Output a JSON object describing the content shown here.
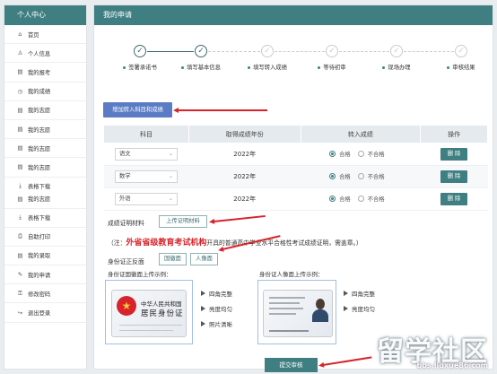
{
  "sidebar": {
    "title": "个人中心",
    "items": [
      {
        "icon": "⌂",
        "label": "首页"
      },
      {
        "icon": "♙",
        "label": "个人信息"
      },
      {
        "icon": "▤",
        "label": "我的报考"
      },
      {
        "icon": "◷",
        "label": "我的成绩"
      },
      {
        "icon": "▤",
        "label": "我的志愿"
      },
      {
        "icon": "▤",
        "label": "我的志愿"
      },
      {
        "icon": "▤",
        "label": "我的志愿"
      },
      {
        "icon": "▤",
        "label": "我的志愿"
      },
      {
        "icon": "⤓",
        "label": "表格下载",
        "sub_icon": "▤",
        "sub_label": "我的志愿"
      },
      {
        "icon": "⤓",
        "label": "表格下载"
      },
      {
        "icon": "⎙",
        "label": "自助打印"
      },
      {
        "icon": "▤",
        "label": "我的录取"
      },
      {
        "icon": "✎",
        "label": "我的申请"
      },
      {
        "icon": "⚿",
        "label": "修改密码"
      },
      {
        "icon": "↪",
        "label": "退出登录"
      }
    ]
  },
  "main": {
    "title": "我的申请",
    "steps": [
      {
        "label": "签署承诺书",
        "done": true
      },
      {
        "label": "填写基本信息",
        "done": true
      },
      {
        "label": "填写转入成绩",
        "done": false
      },
      {
        "label": "等待初审",
        "done": false
      },
      {
        "label": "现场办理",
        "done": false
      },
      {
        "label": "审核结果",
        "done": false
      }
    ],
    "check_glyph": "✓",
    "add_button": "增加转入科目和成绩",
    "table": {
      "headers": [
        "科目",
        "取得成绩年份",
        "转入成绩",
        "操作"
      ],
      "rows": [
        {
          "subject": "语文",
          "year": "2022年",
          "pass": "合格",
          "fail": "不合格",
          "action": "删 除"
        },
        {
          "subject": "数学",
          "year": "2022年",
          "pass": "合格",
          "fail": "不合格",
          "action": "删 除"
        },
        {
          "subject": "外语",
          "year": "2022年",
          "pass": "合格",
          "fail": "不合格",
          "action": "删 除"
        }
      ]
    },
    "proof_label": "成绩证明材料",
    "upload_proof": "上传证明材料",
    "note_prefix": "（注：",
    "note_highlight": "外省省级教育考试机构",
    "note_suffix": "开具的普通高中学业水平合格性考试成绩证明，需盖章。）",
    "id_label": "身份证正反面",
    "emblem_side_btn": "国徽面",
    "portrait_side_btn": "人像面",
    "emblem_sample_title": "身份证国徽面上传示例：",
    "portrait_sample_title": "身份证人像面上传示例：",
    "emblem_card": {
      "line1": "中华人民共和国",
      "line2": "居民身份证"
    },
    "tips_left": [
      "四角完整",
      "亮度均匀",
      "照片清晰"
    ],
    "tips_right": [
      "四角完整",
      "亮度均匀"
    ],
    "submit": "提交审核"
  },
  "watermark": {
    "text": "留学社区",
    "url": "bbs.liuxue86.com"
  },
  "colors": {
    "header": "#3f7f82",
    "add_button": "#5b7cc4",
    "annotation_arrow": "#d8232a"
  }
}
